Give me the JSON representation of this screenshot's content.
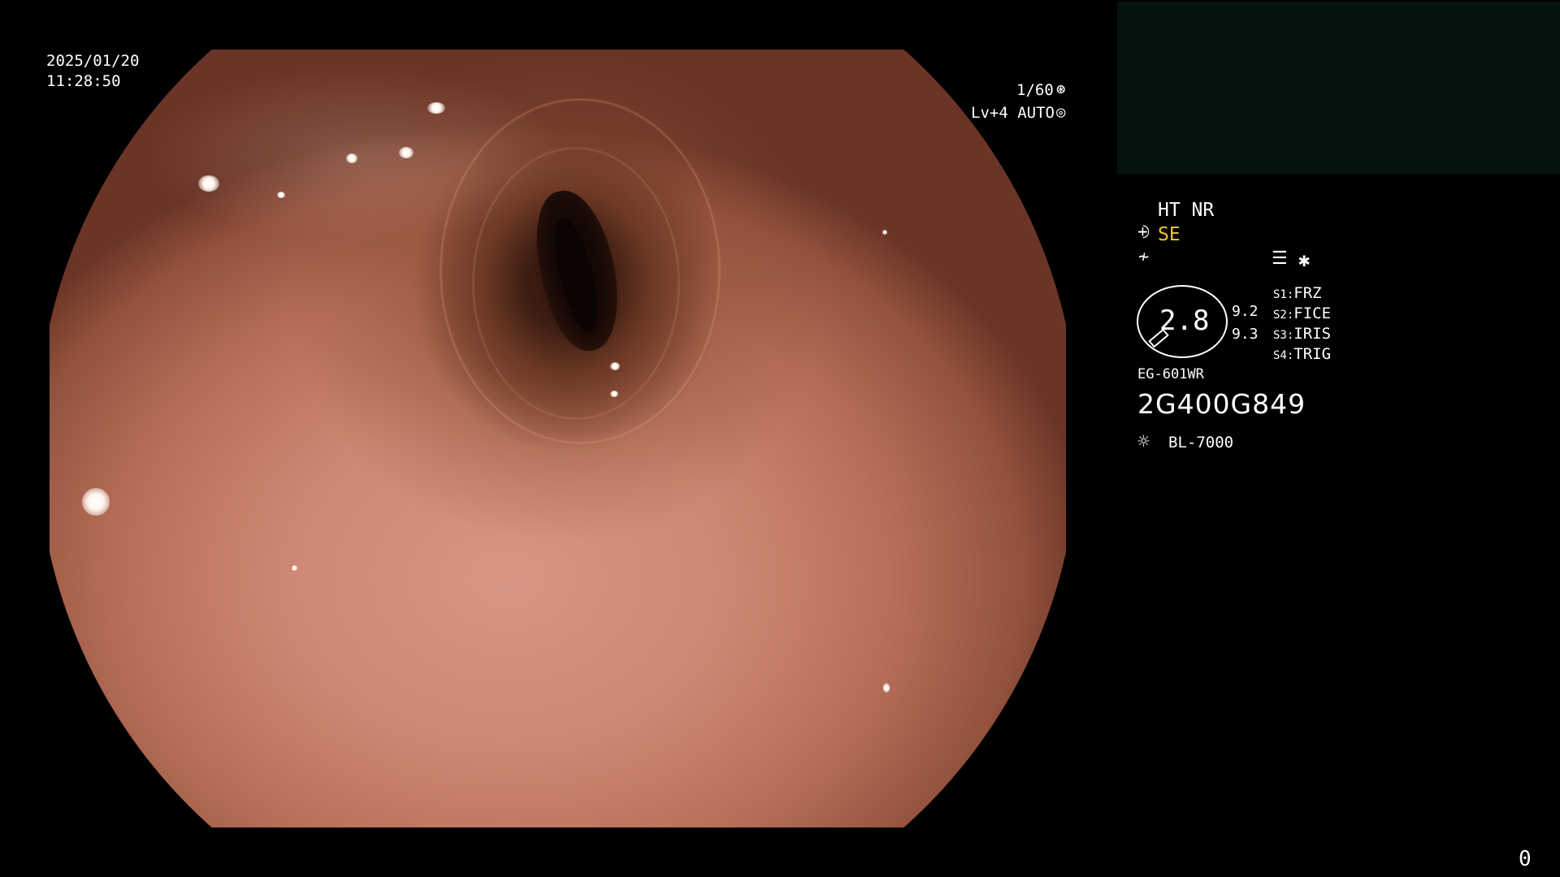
{
  "osd": {
    "date": "2025/01/20",
    "time": "11:28:50",
    "shutter": "1/60",
    "shutter_icon": "shutter-icon",
    "iris_level": "Lv+4 AUTO",
    "iris_icon": "iris-icon"
  },
  "panel": {
    "ht": "HT NR",
    "se": "SE",
    "se_color": "#f3c23c",
    "se_icon": "structure-enhancement-icon",
    "enh_icon": "color-enhancement-icon",
    "menu_icon": "menu-icon",
    "star_icon": "asterisk-icon",
    "gauge_value": "2.8",
    "val1": "9.2",
    "val2": "9.3",
    "switches": [
      {
        "key": "S1:",
        "label": "FRZ"
      },
      {
        "key": "S2:",
        "label": "FICE"
      },
      {
        "key": "S3:",
        "label": "IRIS"
      },
      {
        "key": "S4:",
        "label": "TRIG"
      }
    ],
    "scope_model": "EG-601WR",
    "scope_serial": "2G400G849",
    "light_icon": "light-source-icon",
    "light_source": "BL-7000"
  },
  "counter": "0"
}
